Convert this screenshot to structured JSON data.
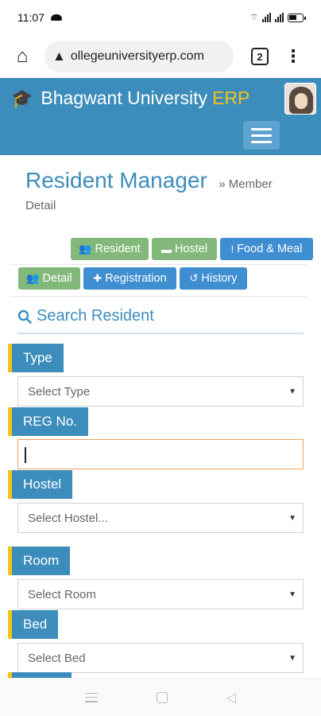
{
  "status_bar": {
    "time": "11:07"
  },
  "browser": {
    "url": "ollegeuniversityerp.com",
    "tab_count": "2"
  },
  "app": {
    "brand": "Bhagwant University",
    "brand_accent": "ERP",
    "accent_color": "#f3c317",
    "header_color": "#3c8dbc"
  },
  "page": {
    "title": "Resident Manager",
    "breadcrumb": "» Member",
    "subtitle": "Detail"
  },
  "top_buttons": [
    {
      "label": "Resident",
      "icon": "users-icon"
    },
    {
      "label": "Hostel",
      "icon": "bed-icon"
    },
    {
      "label": "Food & Meal",
      "icon": "fork-icon"
    }
  ],
  "sub_buttons": [
    {
      "label": "Detail",
      "icon": "users-icon"
    },
    {
      "label": "Registration",
      "icon": "plus-icon"
    },
    {
      "label": "History",
      "icon": "history-icon"
    }
  ],
  "search": {
    "title": "Search Resident"
  },
  "form": {
    "type": {
      "label": "Type",
      "placeholder": "Select Type"
    },
    "reg": {
      "label": "REG No.",
      "value": ""
    },
    "hostel": {
      "label": "Hostel",
      "placeholder": "Select Hostel..."
    },
    "room": {
      "label": "Room",
      "placeholder": "Select Room"
    },
    "bed": {
      "label": "Bed",
      "placeholder": "Select Bed"
    }
  }
}
